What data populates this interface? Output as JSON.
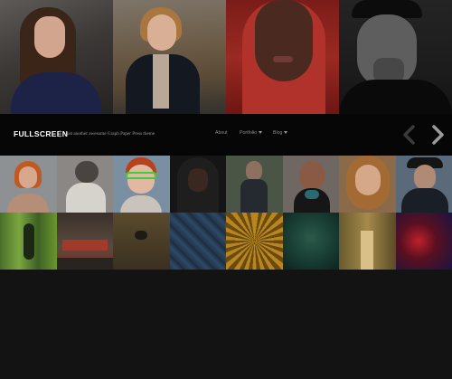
{
  "site": {
    "logo": "FULLSCREEN",
    "tagline": "Just another awesome Graph Paper Press theme"
  },
  "menu": {
    "items": [
      {
        "label": "About",
        "has_dropdown": false
      },
      {
        "label": "Portfolio",
        "has_dropdown": true
      },
      {
        "label": "Blog",
        "has_dropdown": true
      }
    ]
  },
  "nav_arrows": {
    "prev": "chevron-left-icon",
    "next": "chevron-right-icon"
  },
  "colors": {
    "page_background": "#121212",
    "navbar_background": "#060606",
    "logo_text": "#ffffff",
    "menu_text": "#8c8c8c"
  }
}
